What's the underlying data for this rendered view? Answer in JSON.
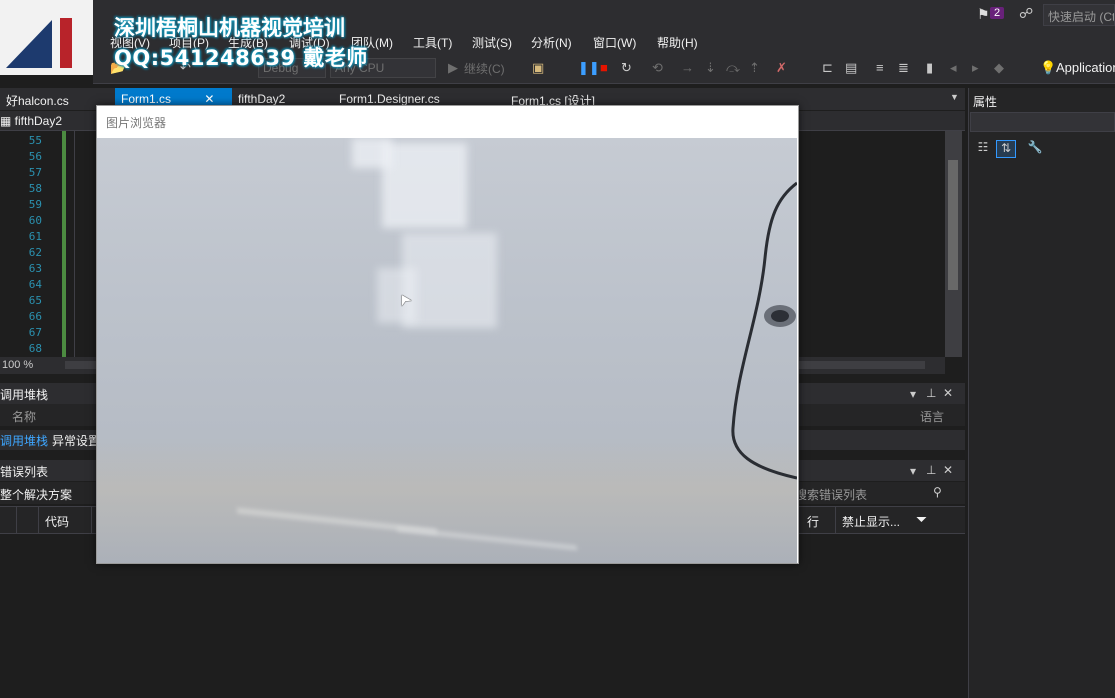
{
  "watermark": {
    "line1": "深圳梧桐山机器视觉培训",
    "line2": "QQ:541248639   戴老师"
  },
  "titlebar": {
    "notification_count": "2",
    "quick_launch_placeholder": "快速启动 (Ctrl+Q)"
  },
  "menu": [
    "视图(V)",
    "项目(P)",
    "生成(B)",
    "调试(D)",
    "团队(M)",
    "工具(T)",
    "测试(S)",
    "分析(N)",
    "窗口(W)",
    "帮助(H)"
  ],
  "toolbar": {
    "config": "Debug",
    "platform": "Any CPU",
    "continue_label": "继续(C)",
    "app_insights": "Application Insights"
  },
  "tabs": [
    {
      "label": "好halcon.cs",
      "active": false
    },
    {
      "label": "Form1.cs",
      "active": true
    },
    {
      "label": "fifthDay2",
      "active": false
    },
    {
      "label": "Form1.Designer.cs",
      "active": false
    },
    {
      "label": "Form1.cs [设计]",
      "active": false
    }
  ],
  "nav": {
    "class_label": "fifthDay2"
  },
  "editor": {
    "line_numbers": [
      "55",
      "56",
      "57",
      "58",
      "59",
      "60",
      "61",
      "62",
      "63",
      "64",
      "65",
      "66",
      "67",
      "68"
    ],
    "zoom": "100 %"
  },
  "callstack": {
    "title": "调用堆栈",
    "col_name": "名称",
    "col_lang": "语言",
    "tab_callstack": "调用堆栈",
    "tab_exceptions": "异常设置"
  },
  "errorlist": {
    "title": "错误列表",
    "scope": "整个解决方案",
    "search_placeholder": "搜索错误列表",
    "columns": {
      "code": "代码",
      "line": "行",
      "suppress": "禁止显示..."
    }
  },
  "properties": {
    "title": "属性"
  },
  "dialog": {
    "title": "图片浏览器"
  },
  "colors": {
    "accent": "#007acc",
    "bg": "#1e1e1e",
    "panel": "#2d2d30",
    "watermark_glow": "#1fb6d6"
  }
}
